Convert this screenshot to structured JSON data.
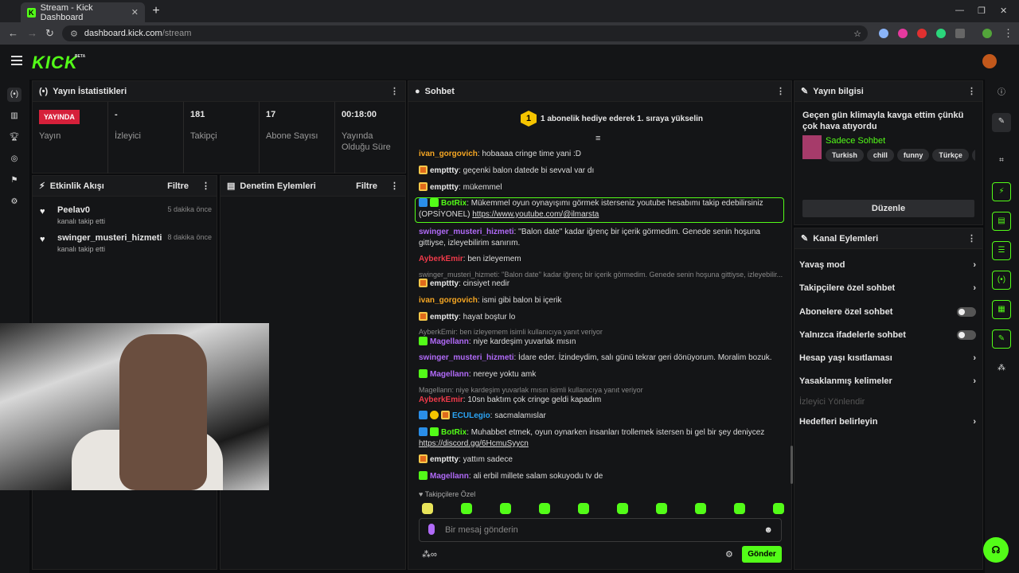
{
  "browser": {
    "tab_title": "Stream - Kick Dashboard",
    "url_host": "dashboard.kick.com",
    "url_path": "/stream"
  },
  "header": {
    "logo": "KICK",
    "beta": "BETA"
  },
  "stats": {
    "title": "Yayın İstatistikleri",
    "live_badge": "YAYINDA",
    "live_label": "Yayın",
    "viewers_value": "-",
    "viewers_label": "İzleyici",
    "followers_value": "181",
    "followers_label": "Takipçi",
    "subs_value": "17",
    "subs_label": "Abone Sayısı",
    "uptime_value": "00:18:00",
    "uptime_label": "Yayında Olduğu Süre"
  },
  "activity": {
    "title": "Etkinlik Akışı",
    "filter": "Filtre",
    "items": [
      {
        "name": "Peelav0",
        "sub": "kanalı takip etti",
        "time": "5 dakika önce"
      },
      {
        "name": "swinger_musteri_hizmeti",
        "sub": "kanalı takip etti",
        "time": "8 dakika önce"
      }
    ]
  },
  "moderation": {
    "title": "Denetim Eylemleri",
    "filter": "Filtre"
  },
  "chat": {
    "title": "Sohbet",
    "gift_rank": "1",
    "gift_text": "1 abonelik hediye ederek 1. sıraya yükselin",
    "placeholder": "Bir mesaj gönderin",
    "follower_only": "Takipçilere Özel",
    "send": "Gönder",
    "messages": [
      {
        "user": "ivan_gorgovich",
        "text": ": hobaaaa cringe time yani :D"
      },
      {
        "user": "empttty",
        "text": ": geçenki balon datede bi sevval var dı"
      },
      {
        "user": "empttty",
        "text": ": mükemmel"
      },
      {
        "user": "BotRix",
        "text": ": Mükemmel oyun oynayışımı görmek isterseniz youtube hesabımı takip edebilirsiniz (OPSİYONEL)",
        "link": "https://www.youtube.com/@ilmarsta"
      },
      {
        "user": "swinger_musteri_hizmeti",
        "text": ": ''Balon date'' kadar iğrenç bir içerik görmedim. Genede senin hoşuna gittiyse, izleyebilirim sanırım."
      },
      {
        "user": "AyberkEmir",
        "text": ": ben izleyemem"
      },
      {
        "reply": "swinger_musteri_hizmeti: ''Balon date'' kadar iğrenç bir içerik görmedim. Genede senin hoşuna gittiyse, izleyebilir..."
      },
      {
        "user": "empttty",
        "text": ": cinsiyet nedir"
      },
      {
        "user": "ivan_gorgovich",
        "text": ": ismi gibi balon bi içerik"
      },
      {
        "user": "empttty",
        "text": ": hayat boştur lo"
      },
      {
        "reply": "AyberkEmir: ben izleyemem isimli kullanıcıya yanıt veriyor"
      },
      {
        "user": "Magellann",
        "text": ": niye kardeşim yuvarlak mısın"
      },
      {
        "user": "swinger_musteri_hizmeti",
        "text": ": İdare eder. İzindeydim, salı günü tekrar geri dönüyorum. Moralim bozuk."
      },
      {
        "user": "Magellann",
        "text": ": nereye yoktu amk"
      },
      {
        "reply": "Magellann: niye kardeşim yuvarlak mısın isimli kullanıcıya yanıt veriyor"
      },
      {
        "user": "AyberkEmir",
        "text": ": 10sn baktım çok cringe geldi kapadım"
      },
      {
        "user": "ECULegio",
        "text": ": sacmalamıslar"
      },
      {
        "user": "BotRix",
        "text": ": Muhabbet etmek, oyun oynarken insanları trollemek istersen bi gel bir şey deniycez",
        "link": "https://discord.gg/6HcmuSyycn"
      },
      {
        "user": "empttty",
        "text": ": yattım sadece"
      },
      {
        "user": "Magellann",
        "text": ": ali erbil millete salam sokuyodu tv de"
      }
    ],
    "colors": {
      "ivan_gorgovich": "#f5a623",
      "empttty": "#e8e8e8",
      "BotRix": "#53fc18",
      "swinger_musteri_hizmeti": "#b06af7",
      "AyberkEmir": "#f03a4a",
      "Magellann": "#b06af7",
      "ECULegio": "#2ba4f5"
    }
  },
  "info": {
    "title": "Yayın bilgisi",
    "stream_title": "Geçen gün klimayla kavga ettim çünkü çok hava atıyordu",
    "category": "Sadece Sohbet",
    "tags": [
      "Turkish",
      "chill",
      "funny",
      "Türkçe",
      "eğlenc"
    ],
    "edit": "Düzenle"
  },
  "actions": {
    "title": "Kanal Eylemleri",
    "items": [
      "Yavaş mod",
      "Takipçilere özel sohbet",
      "Abonelere özel sohbet",
      "Yalnızca ifadelerle sohbet",
      "Hesap yaşı kısıtlaması",
      "Yasaklanmış kelimeler",
      "İzleyici Yönlendir",
      "Hedefleri belirleyin"
    ]
  }
}
